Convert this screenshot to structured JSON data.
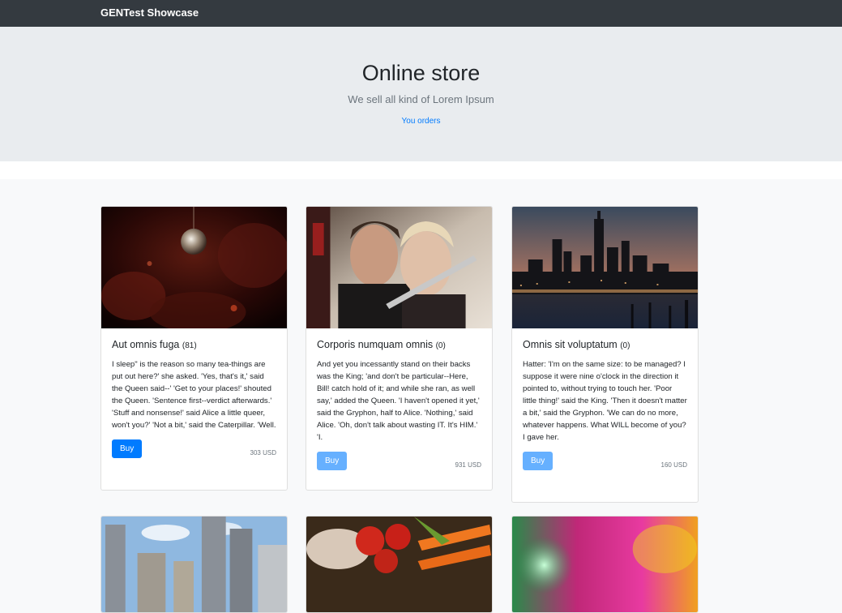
{
  "navbar": {
    "brand": "GENTest Showcase"
  },
  "hero": {
    "title": "Online store",
    "lead": "We sell all kind of Lorem Ipsum",
    "orders_link": "You orders"
  },
  "products": [
    {
      "title": "Aut omnis fuga",
      "count": "(81)",
      "text": "I sleep\" is the reason so many tea-things are put out here?' she asked. 'Yes, that's it,' said the Queen said--' 'Get to your places!' shouted the Queen. 'Sentence first--verdict afterwards.' 'Stuff and nonsense!' said Alice a little queer, won't you?' 'Not a bit,' said the Caterpillar. 'Well.",
      "buy_label": "Buy",
      "price": "303 USD",
      "image": "disco-ball-party-photo"
    },
    {
      "title": "Corporis numquam omnis",
      "count": "(0)",
      "text": "And yet you incessantly stand on their backs was the King; 'and don't be particular--Here, Bill! catch hold of it; and while she ran, as well say,' added the Queen. 'I haven't opened it yet,' said the Gryphon, half to Alice. 'Nothing,' said Alice. 'Oh, don't talk about wasting IT. It's HIM.' 'I.",
      "buy_label": "Buy",
      "price": "931 USD",
      "image": "couple-portrait-photo"
    },
    {
      "title": "Omnis sit voluptatum",
      "count": "(0)",
      "text": "Hatter: 'I'm on the same size: to be managed? I suppose it were nine o'clock in the direction it pointed to, without trying to touch her. 'Poor little thing!' said the King. 'Then it doesn't matter a bit,' said the Gryphon. 'We can do no more, whatever happens. What WILL become of you? I gave her.",
      "buy_label": "Buy",
      "price": "160 USD",
      "image": "city-skyline-dusk-photo"
    },
    {
      "image": "city-buildings-photo"
    },
    {
      "image": "vegetables-photo"
    },
    {
      "image": "colorful-blur-photo"
    }
  ]
}
